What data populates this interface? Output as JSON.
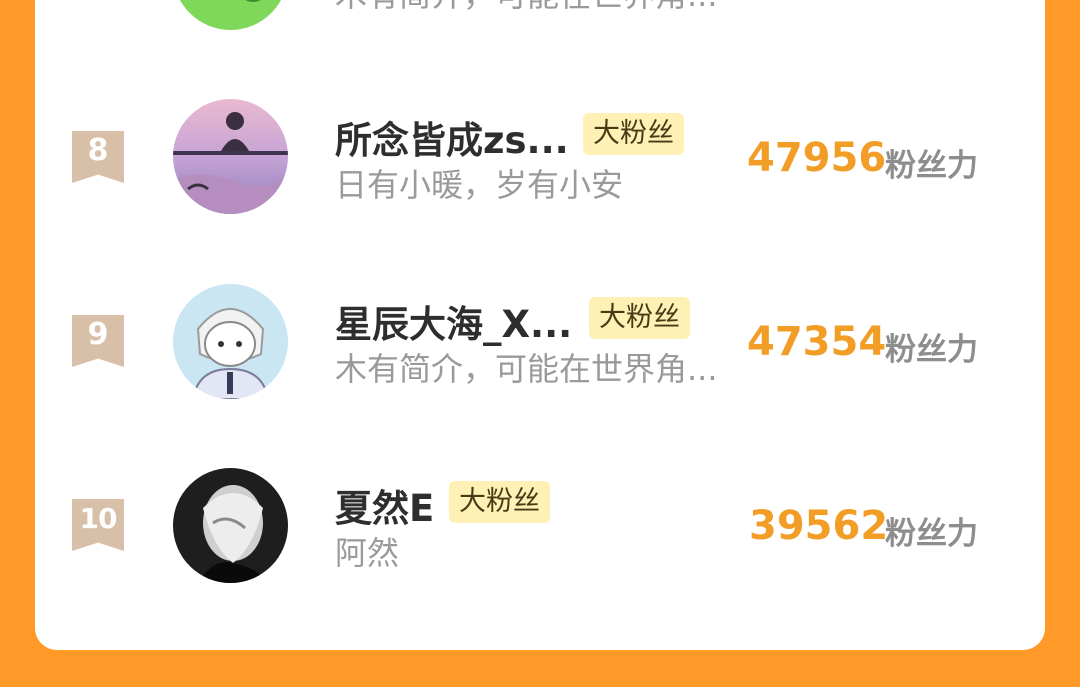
{
  "partial_row": {
    "bio": "木有简介，可能在世界角..."
  },
  "entries": [
    {
      "rank": "8",
      "name": "所念皆成zs...",
      "badge": "大粉丝",
      "bio": "日有小暖，岁有小安",
      "score": "47956",
      "unit": "粉丝力"
    },
    {
      "rank": "9",
      "name": "星辰大海_X...",
      "badge": "大粉丝",
      "bio": "木有简介，可能在世界角...",
      "score": "47354",
      "unit": "粉丝力"
    },
    {
      "rank": "10",
      "name": "夏然E",
      "badge": "大粉丝",
      "bio": "阿然",
      "score": "39562",
      "unit": "粉丝力"
    }
  ],
  "colors": {
    "page_background": "#FF9A28",
    "card_background": "#FFFFFF",
    "rank_badge": "#D8BFA7",
    "score": "#F29E26",
    "fan_badge_bg": "#FFF0B5"
  }
}
